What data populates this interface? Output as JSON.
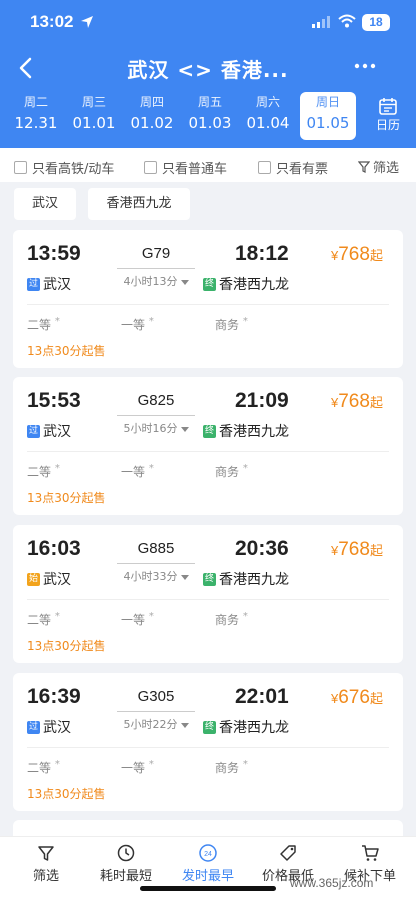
{
  "status_bar": {
    "time": "13:02",
    "battery": "18"
  },
  "navbar": {
    "title": "武汉 <> 香港..."
  },
  "dates": [
    {
      "dow": "周二",
      "md": "12.31",
      "active": false
    },
    {
      "dow": "周三",
      "md": "01.01",
      "active": false
    },
    {
      "dow": "周四",
      "md": "01.02",
      "active": false
    },
    {
      "dow": "周五",
      "md": "01.03",
      "active": false
    },
    {
      "dow": "周六",
      "md": "01.04",
      "active": false
    },
    {
      "dow": "周日",
      "md": "01.05",
      "active": true
    }
  ],
  "calendar_label": "日历",
  "filters": {
    "high_speed": "只看高铁/动车",
    "normal": "只看普通车",
    "available": "只看有票",
    "filter": "筛选"
  },
  "stations": {
    "from": "武汉",
    "to": "香港西九龙"
  },
  "trains": [
    {
      "dep": "13:59",
      "arr": "18:12",
      "train_no": "G79",
      "duration": "4小时13分",
      "from_tag": "过",
      "from_type": "pass",
      "from": "武汉",
      "to_tag": "终",
      "to": "香港西九龙",
      "currency": "¥",
      "price": "768",
      "price_suffix": "起",
      "seat_2": "二等",
      "seat_1": "一等",
      "seat_biz": "商务",
      "sale": "13点30分起售"
    },
    {
      "dep": "15:53",
      "arr": "21:09",
      "train_no": "G825",
      "duration": "5小时16分",
      "from_tag": "过",
      "from_type": "pass",
      "from": "武汉",
      "to_tag": "终",
      "to": "香港西九龙",
      "currency": "¥",
      "price": "768",
      "price_suffix": "起",
      "seat_2": "二等",
      "seat_1": "一等",
      "seat_biz": "商务",
      "sale": "13点30分起售"
    },
    {
      "dep": "16:03",
      "arr": "20:36",
      "train_no": "G885",
      "duration": "4小时33分",
      "from_tag": "始",
      "from_type": "start",
      "from": "武汉",
      "to_tag": "终",
      "to": "香港西九龙",
      "currency": "¥",
      "price": "768",
      "price_suffix": "起",
      "seat_2": "二等",
      "seat_1": "一等",
      "seat_biz": "商务",
      "sale": "13点30分起售"
    },
    {
      "dep": "16:39",
      "arr": "22:01",
      "train_no": "G305",
      "duration": "5小时22分",
      "from_tag": "过",
      "from_type": "pass",
      "from": "武汉",
      "to_tag": "终",
      "to": "香港西九龙",
      "currency": "¥",
      "price": "676",
      "price_suffix": "起",
      "seat_2": "二等",
      "seat_1": "一等",
      "seat_biz": "商务",
      "sale": "13点30分起售"
    }
  ],
  "seat_mark": "*",
  "bottom_tabs": [
    {
      "label": "筛选",
      "icon": "filter-icon",
      "active": false
    },
    {
      "label": "耗时最短",
      "icon": "clock-icon",
      "active": false
    },
    {
      "label": "发时最早",
      "icon": "clock-24-icon",
      "active": true,
      "badge": "24"
    },
    {
      "label": "价格最低",
      "icon": "price-tag-icon",
      "active": false
    },
    {
      "label": "候补下单",
      "icon": "cart-icon",
      "active": false
    }
  ],
  "watermark": "www.365jz.com",
  "colors": {
    "primary": "#3f86f2",
    "price": "#f08a1c",
    "pass_tag": "#3f86f2",
    "end_tag": "#3bb26b",
    "start_tag": "#f2a31c"
  }
}
